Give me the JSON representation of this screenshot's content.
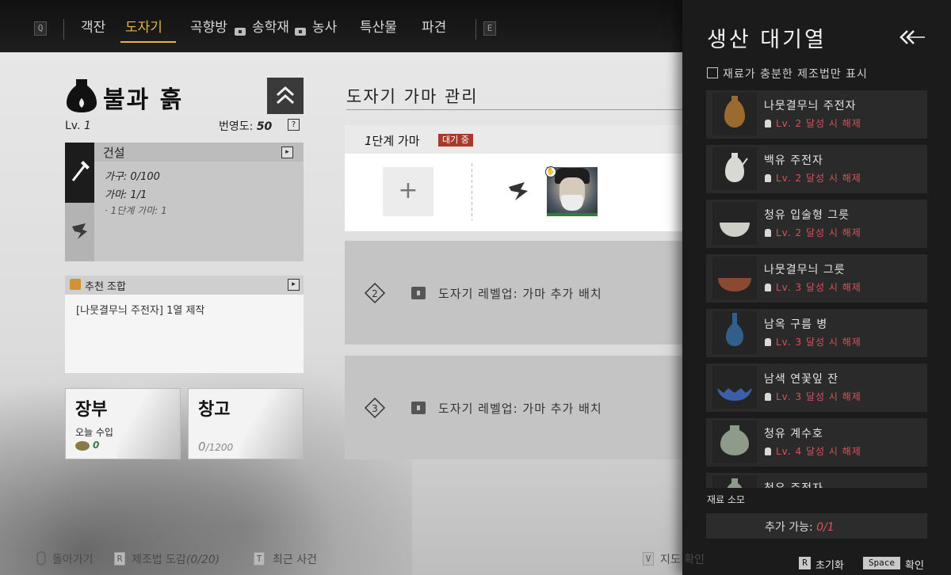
{
  "top_nav": {
    "key_left": "Q",
    "key_right": "E",
    "tabs": [
      {
        "label": "객잔"
      },
      {
        "label": "도자기"
      },
      {
        "label": "곡향방"
      },
      {
        "label": "송학재"
      },
      {
        "label": "농사"
      },
      {
        "label": "특산물"
      },
      {
        "label": "파견"
      }
    ],
    "active_tab": "도자기",
    "accent_color": "#e2b44b"
  },
  "left_panel": {
    "title": "불과 흙",
    "lv_label": "Lv.",
    "lv_value": "1",
    "prosperity_label": "번영도:",
    "prosperity_value": "50",
    "help": "?",
    "build": {
      "title": "건설",
      "furniture": "가구: 0/100",
      "kiln": "가마: 1/1",
      "kiln_detail": "· 1단계 가마: 1"
    },
    "recommend": {
      "title": "추천 조합",
      "text": "[나뭇결무늬 주전자] 1열 제작"
    },
    "ledger": {
      "title": "장부",
      "sub": "오늘 수입",
      "value": "0"
    },
    "storage": {
      "title": "창고",
      "current": "0",
      "max": "/1200"
    }
  },
  "center_panel": {
    "title": "도자기 가마 관리",
    "kiln1": {
      "label_num": "1",
      "label": "단계 가마",
      "status": "대기 중",
      "add_symbol": "+"
    },
    "locked_slots": [
      {
        "text": "도자기 레벨업: 가마 추가 배치"
      },
      {
        "text": "도자기 레벨업: 가마 추가 배치"
      }
    ]
  },
  "queue_panel": {
    "title": "생산 대기열",
    "filter_label": "재료가 충분한 제조법만 표시",
    "recipes": [
      {
        "name": "나뭇결무늬 주전자",
        "lv": "Lv. 2",
        "cond": "달성 시 해제",
        "vessel": "ewer-brown"
      },
      {
        "name": "백유 주전자",
        "lv": "Lv. 2",
        "cond": "달성 시 해제",
        "vessel": "ewer-white"
      },
      {
        "name": "청유 입술형 그릇",
        "lv": "Lv. 2",
        "cond": "달성 시 해제",
        "vessel": "bowl-white"
      },
      {
        "name": "나뭇결무늬 그릇",
        "lv": "Lv. 3",
        "cond": "달성 시 해제",
        "vessel": "bowl-brown"
      },
      {
        "name": "남옥 구름 병",
        "lv": "Lv. 3",
        "cond": "달성 시 해제",
        "vessel": "vase-blue"
      },
      {
        "name": "남색 연꽃잎 잔",
        "lv": "Lv. 3",
        "cond": "달성 시 해제",
        "vessel": "cup-blue"
      },
      {
        "name": "청유 계수호",
        "lv": "Lv. 4",
        "cond": "달성 시 해제",
        "vessel": "jar-celadon"
      },
      {
        "name": "청유 주전자",
        "lv": "",
        "cond": "",
        "vessel": "ewer-celadon"
      }
    ],
    "material_label": "재료 소모",
    "available_label": "추가 가능:",
    "available_value": "0/1",
    "reset_key": "R",
    "reset_label": "초기화",
    "confirm_key": "Space",
    "confirm_label": "확인",
    "lock_color": "#d7535b"
  },
  "bottom_hints": {
    "back_label": "돌아가기",
    "codex_key": "R",
    "codex_label": "제조법 도감",
    "codex_count": "(0/20)",
    "events_key": "T",
    "events_label": "최근 사건",
    "map_key": "V",
    "map_label": "지도 확인"
  }
}
